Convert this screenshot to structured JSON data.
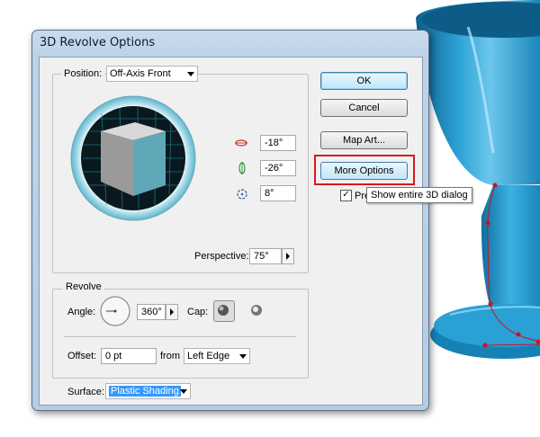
{
  "dialog": {
    "title": "3D Revolve Options",
    "position": {
      "label": "Position:",
      "value": "Off-Axis Front",
      "rot_x": "-18°",
      "rot_y": "-26°",
      "rot_z": "8°",
      "perspective_label": "Perspective:",
      "perspective": "75°"
    },
    "revolve": {
      "label": "Revolve",
      "angle_label": "Angle:",
      "angle": "360°",
      "cap_label": "Cap:",
      "offset_label": "Offset:",
      "offset": "0 pt",
      "from_label": "from",
      "from_value": "Left Edge"
    },
    "surface": {
      "label": "Surface:",
      "value": "Plastic Shading"
    },
    "buttons": {
      "ok": "OK",
      "cancel": "Cancel",
      "map_art": "Map Art...",
      "more_options": "More Options"
    },
    "preview_label": "Pre",
    "preview_checked": true,
    "tooltip": "Show entire 3D dialog"
  },
  "colors": {
    "highlight": "#d7191e",
    "goblet": "#1f8ec0",
    "path": "#cc1122"
  }
}
